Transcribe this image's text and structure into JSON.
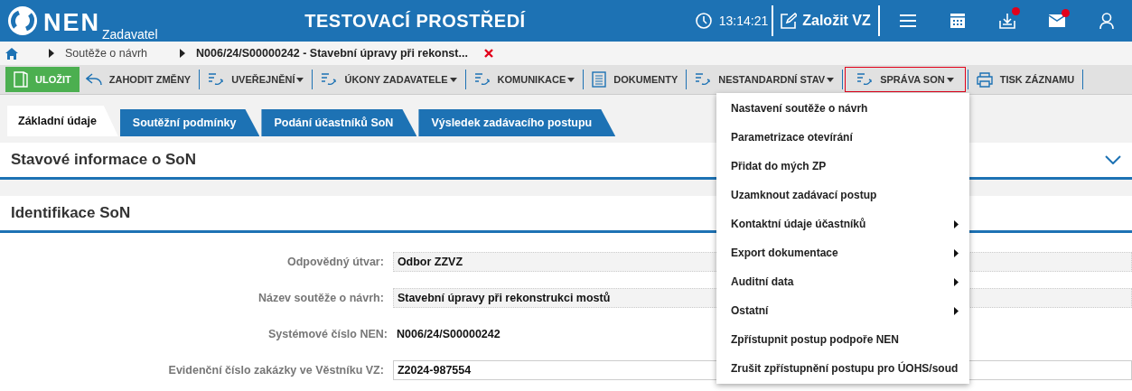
{
  "header": {
    "logo": "NEN",
    "subtitle": "Zadavatel",
    "title": "TESTOVACÍ PROSTŘEDÍ",
    "time": "13:14:21",
    "create_button": "Založit VZ",
    "icons": [
      {
        "kind": "menu",
        "badge": false
      },
      {
        "kind": "calendar",
        "badge": false
      },
      {
        "kind": "inbox",
        "badge": true
      },
      {
        "kind": "mail",
        "badge": true
      },
      {
        "kind": "user",
        "badge": false
      }
    ]
  },
  "breadcrumb": [
    "Soutěže o návrh",
    "N006/24/S00000242 - Stavební úpravy při rekonst..."
  ],
  "toolbar": [
    {
      "kind": "save",
      "label": "ULOŽIT",
      "dropdown": false,
      "selected": false
    },
    {
      "kind": "undo",
      "label": "ZAHODIT ZMĚNY",
      "dropdown": false,
      "selected": false
    },
    {
      "kind": "flow",
      "label": "UVEŘEJNĚNÍ",
      "dropdown": true,
      "selected": false
    },
    {
      "kind": "flow",
      "label": "ÚKONY ZADAVATELE",
      "dropdown": true,
      "selected": false
    },
    {
      "kind": "flow",
      "label": "KOMUNIKACE",
      "dropdown": true,
      "selected": false
    },
    {
      "kind": "doc",
      "label": "DOKUMENTY",
      "dropdown": false,
      "selected": false
    },
    {
      "kind": "flow",
      "label": "NESTANDARDNÍ STAV",
      "dropdown": true,
      "selected": false
    },
    {
      "kind": "flow",
      "label": "SPRÁVA SON",
      "dropdown": true,
      "selected": true
    },
    {
      "kind": "print",
      "label": "TISK ZÁZNAMU",
      "dropdown": false,
      "selected": false
    }
  ],
  "tabs": [
    {
      "label": "Základní údaje",
      "selected": true
    },
    {
      "label": "Soutěžní podmínky",
      "selected": false
    },
    {
      "label": "Podání účastníků SoN",
      "selected": false
    },
    {
      "label": "Výsledek zadávacího postupu",
      "selected": false
    }
  ],
  "sections": [
    {
      "title": "Stavové informace o SoN",
      "expanded": false
    },
    {
      "title": "Identifikace SoN",
      "expanded": true
    }
  ],
  "fields": [
    {
      "kind": "readonly",
      "label": "Odpovědný útvar:",
      "value": "Odbor ZZVZ"
    },
    {
      "kind": "readonly",
      "label": "Název soutěže o návrh:",
      "value": "Stavební úpravy při rekonstrukci mostů"
    },
    {
      "kind": "text",
      "label": "Systémové číslo NEN:",
      "value": "N006/24/S00000242"
    },
    {
      "kind": "input",
      "label": "Evidenční číslo zakázky ve Věstníku VZ:",
      "value": "Z2024-987554"
    }
  ],
  "menu": [
    {
      "label": "Nastavení soutěže o návrh",
      "submenu": false
    },
    {
      "label": "Parametrizace otevírání",
      "submenu": false
    },
    {
      "label": "Přidat do mých ZP",
      "submenu": false
    },
    {
      "label": "Uzamknout zadávací postup",
      "submenu": false
    },
    {
      "label": "Kontaktní údaje účastníků",
      "submenu": true
    },
    {
      "label": "Export dokumentace",
      "submenu": true
    },
    {
      "label": "Auditní data",
      "submenu": true
    },
    {
      "label": "Ostatní",
      "submenu": true
    },
    {
      "label": "Zpřístupnit postup podpoře NEN",
      "submenu": false
    },
    {
      "label": "Zrušit zpřístupnění postupu pro ÚOHS/soud",
      "submenu": false
    }
  ]
}
